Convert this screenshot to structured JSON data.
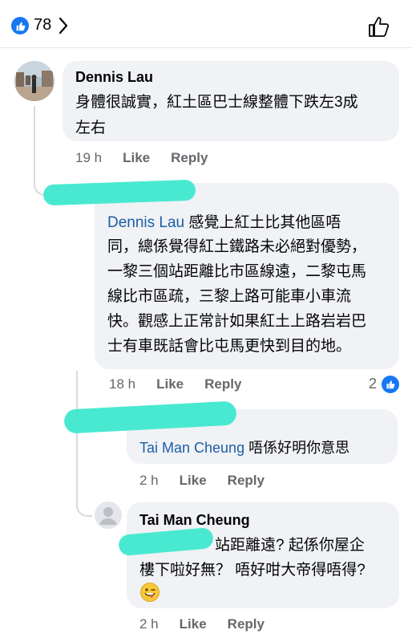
{
  "header": {
    "reaction_count": "78",
    "like_icon_color": "#1877f2"
  },
  "comments": [
    {
      "name": "Dennis Lau",
      "text_line1": "身體很誠實，紅土區巴士線整體下跌左3成",
      "text_line2": "左右",
      "time": "19 h",
      "like": "Like",
      "reply": "Reply"
    },
    {
      "mention": "Dennis Lau",
      "lines": [
        " 感覺上紅土比其他區唔",
        "同，總係覺得紅土鐵路未必絕對優勢，",
        "一黎三個站距離比市區線遠，二黎屯馬",
        "線比市區疏，三黎上路可能車小車流",
        "快。觀感上正常計如果紅土上路岩岩巴",
        "士有車既話會比屯馬更快到目的地。"
      ],
      "time": "18 h",
      "like": "Like",
      "reply": "Reply",
      "reaction_count": "2"
    },
    {
      "mention": "Tai Man Cheung",
      "text": " 唔係好明你意思",
      "time": "2 h",
      "like": "Like",
      "reply": "Reply"
    },
    {
      "name": "Tai Man Cheung",
      "line1": "站距離遠? 起係你屋企",
      "line2": "樓下啦好無？ 唔好咁大帝得唔得?",
      "time": "2 h",
      "like": "Like",
      "reply": "Reply"
    }
  ]
}
